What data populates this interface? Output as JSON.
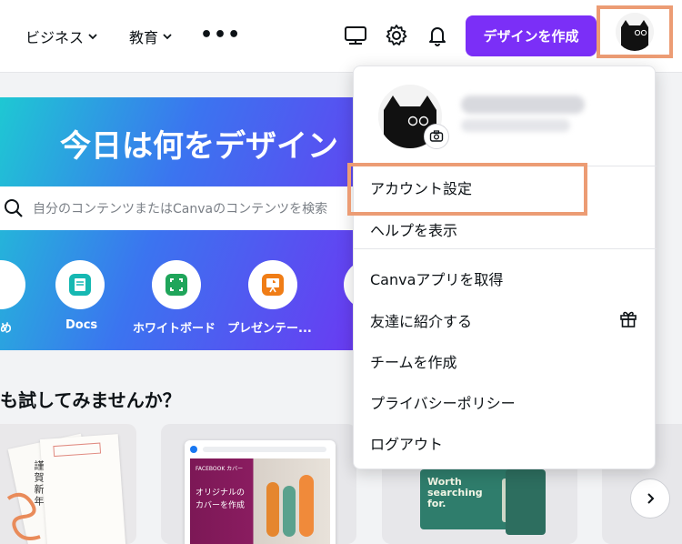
{
  "topbar": {
    "nav": [
      "ビジネス",
      "教育"
    ],
    "more": "•••",
    "create_button": "デザインを作成"
  },
  "hero": {
    "title": "今日は何をデザイン",
    "search_placeholder": "自分のコンテンツまたはCanvaのコンテンツを検索",
    "shortcuts": [
      "め",
      "Docs",
      "ホワイトボード",
      "プレゼンテー..."
    ]
  },
  "section": {
    "title": "も試してみませんか？"
  },
  "cards": {
    "nengajo_text": "謹賀新年",
    "facebook_badge": "FACEBOOK カバー",
    "facebook_text_1": "オリジナルの",
    "facebook_text_2": "カバーを作成",
    "promo_text_1": "Worth",
    "promo_text_2": "searching",
    "promo_text_3": "for."
  },
  "menu": {
    "items": [
      {
        "label": "アカウント設定"
      },
      {
        "label": "ヘルプを表示"
      },
      {
        "label": "Canvaアプリを取得"
      },
      {
        "label": "友達に紹介する"
      },
      {
        "label": "チームを作成"
      },
      {
        "label": "プライバシーポリシー"
      },
      {
        "label": "ログアウト"
      }
    ]
  },
  "colors": {
    "brand_purple": "#7b2ff7",
    "highlight": "#ec9c74"
  }
}
